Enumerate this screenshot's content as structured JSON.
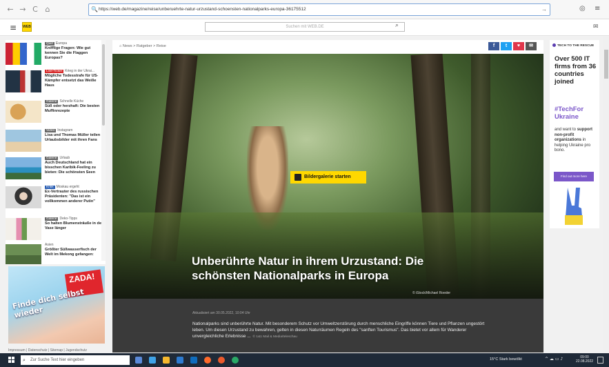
{
  "browser": {
    "url": "https://web.de/magazine/reise/unberuehrte-natur-urzustand-schoensten-nationalparks-europa-36175512",
    "back": "←",
    "forward": "→",
    "reload": "C",
    "home": "⌂"
  },
  "header": {
    "logo_text": "WEB",
    "search_placeholder": "Suchen mit WEB.DE"
  },
  "sidebar": {
    "items": [
      {
        "badge": "Quiz",
        "badge_color": "grey",
        "category": "Europa",
        "title": "Knifflige Fragen: Wie gut kennen Sie die Flaggen Europas?"
      },
      {
        "badge": "Live-Ticker",
        "badge_color": "red",
        "category": "Krieg in der Ukrai...",
        "title": "Mögliche Todesstrafe für US-Kämpfer entsetzt das Weiße Haus"
      },
      {
        "badge": "Galerie",
        "badge_color": "grey",
        "category": "Schnelle Küche",
        "title": "Süß oder herzhaft: Die besten Muffinrezepte"
      },
      {
        "badge": "Video",
        "badge_color": "grey",
        "category": "Instagram",
        "title": "Lisa und Thomas Müller teilen Urlaubsbilder mit ihren Fans"
      },
      {
        "badge": "Galerie",
        "badge_color": "grey",
        "category": "Urlaub",
        "title": "Auch Deutschland hat ein bisschen Karibik-Feeling zu bieten: Die schönsten Seen"
      },
      {
        "badge": "Kritik",
        "badge_color": "blue",
        "category": "Moskau ergeht",
        "title": "Ex-Vertrauter des russischen Präsidenten: \"Das ist ein vollkommen anderer Putin\""
      },
      {
        "badge": "Galerie",
        "badge_color": "grey",
        "category": "Deko-Tipps",
        "title": "So halten Blumensträuße in der Vase länger"
      },
      {
        "badge": "",
        "badge_color": "grey",
        "category": "Asien",
        "title": "Größter Süßwasserfisch der Welt im Mekong gefangen:"
      }
    ]
  },
  "left_ad": {
    "text": "Finde dich selbst wieder",
    "brand": "ZADA!"
  },
  "footer_links": "Impressum | Datenschutz | Sitemap | Jugendschutz",
  "main": {
    "breadcrumb": "News > Ratgeber > Reise",
    "share": {
      "facebook": "f",
      "twitter": "t",
      "pocket": "♥",
      "mail": "✉"
    },
    "gallery_button": "Bildergalerie starten",
    "headline": "Unberührte Natur in ihrem Urzustand: Die schönsten Nationalparks in Europa",
    "credit": "© iStock/Michael Roeder",
    "date": "Aktualisiert am 30.05.2022, 10:04 Uhr",
    "body": "Nationalparks sind unberührte Natur. Mit besonderem Schutz vor Umweltzerstörung durch menschliche Eingriffe können Tiere und Pflanzen ungestört leben. Um diesen Urzustand zu bewahren, gelten in diesen Naturräumen Regeln des \"sanften Tourismus\". Das bietet vor allem für Wanderer unvergleichliche Erlebnisse ...",
    "source": "© 1&1 Mail & Media/teleschau"
  },
  "right_ad": {
    "brand": "TECH TO THE RESCUE",
    "big": "Over 500 IT firms from 36 countries joined",
    "hashtag": "#TechFor Ukraine",
    "small_pre": "and want to ",
    "small_bold": "support non-profit organizations",
    "small_post": " in helping Ukraine pro bono.",
    "cta": "Find out more here"
  },
  "taskbar": {
    "search_placeholder": "Zur Suche Text hier eingeben",
    "weather": "15°C  Stark bewölkt",
    "time": "09:00",
    "date": "22.08.2022"
  },
  "colors": {
    "accent": "#ffd800",
    "ad_purple": "#7b57c9",
    "dark_panel": "#3a3a3a"
  }
}
